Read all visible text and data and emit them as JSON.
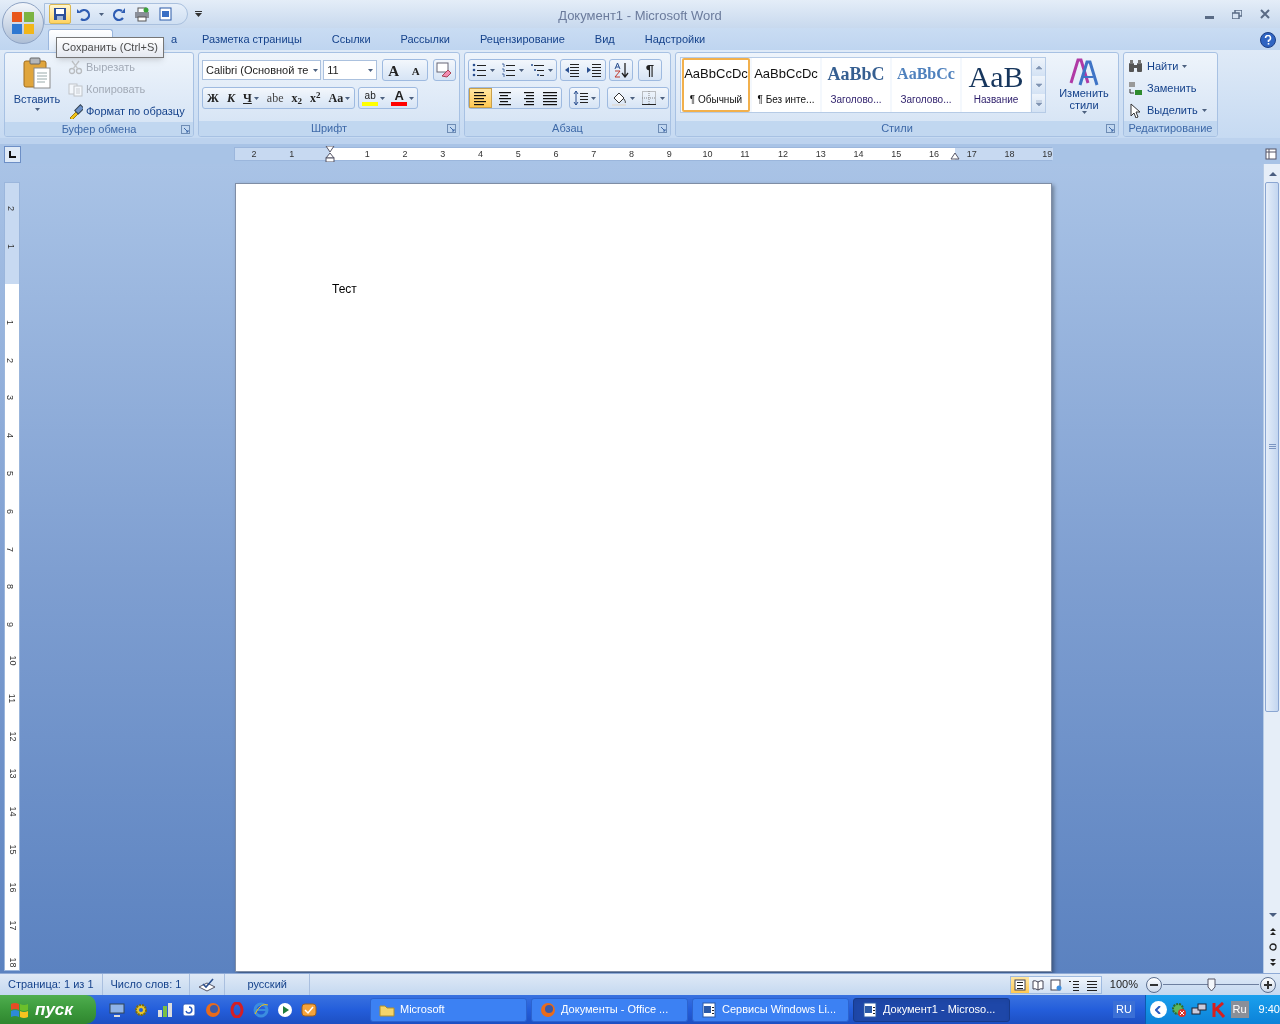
{
  "window": {
    "title": "Документ1 - Microsoft Word"
  },
  "quick_access": [
    {
      "kind": "save",
      "highlighted": true
    },
    {
      "kind": "undo",
      "highlighted": false
    },
    {
      "kind": "redo",
      "highlighted": false
    },
    {
      "kind": "print",
      "highlighted": false
    },
    {
      "kind": "preview",
      "highlighted": false
    }
  ],
  "tooltip": "Сохранить (Ctrl+S)",
  "tabs": [
    {
      "selected": true
    },
    {
      "label": "а",
      "selected": false
    },
    {
      "label": "Разметка страницы",
      "selected": false
    },
    {
      "label": "Ссылки",
      "selected": false
    },
    {
      "label": "Рассылки",
      "selected": false
    },
    {
      "label": "Рецензирование",
      "selected": false
    },
    {
      "label": "Вид",
      "selected": false
    },
    {
      "label": "Надстройки",
      "selected": false
    }
  ],
  "clipboard": {
    "title": "Буфер обмена",
    "paste": "Вставить",
    "items": [
      {
        "kind": "cut",
        "label": "Вырезать",
        "disabled": true
      },
      {
        "kind": "copy",
        "label": "Копировать",
        "disabled": true
      },
      {
        "kind": "format",
        "label": "Формат по образцу",
        "disabled": false
      }
    ]
  },
  "font": {
    "title": "Шрифт",
    "name": "Calibri (Основной те",
    "size": "11",
    "grow": "A",
    "shrink": "A",
    "formats": [
      {
        "kind": "bold",
        "label": "Ж",
        "dropdown": false
      },
      {
        "kind": "italic",
        "label": "К",
        "dropdown": false
      },
      {
        "kind": "underline",
        "label": "Ч",
        "dropdown": true
      },
      {
        "kind": "strike",
        "label": "abe",
        "dropdown": false
      },
      {
        "kind": "sub",
        "label": "x$_{2}$",
        "dropdown": false
      },
      {
        "kind": "sup",
        "label": "x$^{2}$",
        "dropdown": false
      },
      {
        "kind": "case",
        "label": "Aa",
        "dropdown": true
      }
    ],
    "highlight": {
      "label": "ab",
      "color": "#ffff00"
    },
    "font_color": {
      "label": "A",
      "color": "#ff0000"
    }
  },
  "paragraph": {
    "title": "Абзац",
    "pilcrow": "¶",
    "alignments": [
      {
        "kind": "left",
        "selected": true
      },
      {
        "kind": "center",
        "selected": false
      },
      {
        "kind": "right",
        "selected": false
      },
      {
        "kind": "justify",
        "selected": false
      }
    ]
  },
  "styles": {
    "title": "Стили",
    "change_styles": "Изменить стили",
    "items": [
      {
        "kind": "normal",
        "sample": "AaBbCcDc",
        "name": "¶ Обычный",
        "selected": true
      },
      {
        "kind": "no-spacing",
        "sample": "AaBbCcDc",
        "name": "¶ Без инте...",
        "selected": false
      },
      {
        "kind": "heading1",
        "sample": "AaBbC",
        "name": "Заголово...",
        "selected": false
      },
      {
        "kind": "heading2",
        "sample": "AaBbCc",
        "name": "Заголово...",
        "selected": false
      },
      {
        "kind": "title",
        "sample": "AaB",
        "name": "Название",
        "selected": false
      }
    ]
  },
  "editing": {
    "title": "Редактирование",
    "items": [
      {
        "kind": "find",
        "label": "Найти",
        "dropdown": true
      },
      {
        "kind": "replace",
        "label": "Заменить",
        "dropdown": false
      },
      {
        "kind": "select",
        "label": "Выделить",
        "dropdown": true
      }
    ]
  },
  "ruler": {
    "left_numbers": [
      "2",
      "1"
    ],
    "numbers": [
      "1",
      "2",
      "3",
      "4",
      "5",
      "6",
      "7",
      "8",
      "9",
      "10",
      "11",
      "12",
      "13",
      "14",
      "15",
      "16",
      "17",
      "18",
      "19"
    ]
  },
  "vertical_ruler": {
    "top_numbers": [
      "2",
      "1"
    ],
    "numbers": [
      "1",
      "2",
      "3",
      "4",
      "5",
      "6",
      "7",
      "8",
      "9",
      "10",
      "11",
      "12",
      "13",
      "14",
      "15",
      "16",
      "17",
      "18"
    ]
  },
  "document": {
    "paragraphs": [
      "Тест"
    ]
  },
  "status_bar": {
    "page": "Страница: 1 из 1",
    "words": "Число слов: 1",
    "language": "русский",
    "views": [
      {
        "kind": "print",
        "selected": true
      },
      {
        "kind": "reading",
        "selected": false
      },
      {
        "kind": "web",
        "selected": false
      },
      {
        "kind": "outline",
        "selected": false
      },
      {
        "kind": "draft",
        "selected": false
      }
    ],
    "zoom": "100%",
    "zoom_slider": {
      "level": 0.5
    }
  },
  "taskbar": {
    "start": "пуск",
    "quick_launch": [
      {
        "kind": "desktop"
      },
      {
        "kind": "tool"
      },
      {
        "kind": "network"
      },
      {
        "kind": "update"
      },
      {
        "kind": "orange"
      },
      {
        "kind": "red"
      },
      {
        "kind": "blue"
      },
      {
        "kind": "media"
      },
      {
        "kind": "mail"
      }
    ],
    "tasks": [
      {
        "kind": "folder",
        "label": "Microsoft",
        "selected": false
      },
      {
        "kind": "orange",
        "label": "Документы - Office ...",
        "selected": false
      },
      {
        "kind": "word",
        "label": "Сервисы Windows Li...",
        "selected": false
      },
      {
        "kind": "word",
        "label": "Документ1 - Microso...",
        "selected": true
      }
    ],
    "language": "RU",
    "tray_language": "Ru",
    "clock": "9:40"
  }
}
